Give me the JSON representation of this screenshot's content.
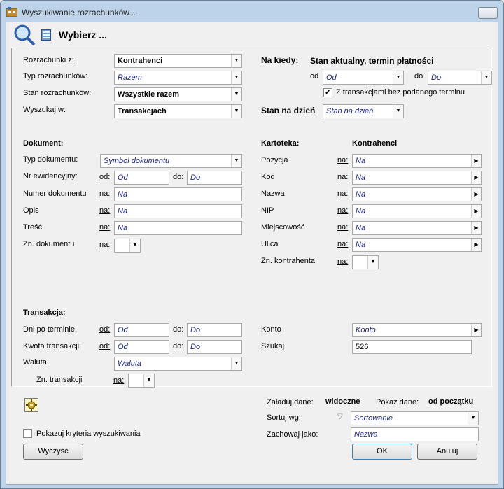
{
  "window": {
    "title": "Wyszukiwanie rozrachunków...",
    "close_glyph": "✕"
  },
  "header": {
    "title": "Wybierz ..."
  },
  "left_top": {
    "rozrachunki_label": "Rozrachunki z:",
    "rozrachunki_value": "Kontrahenci",
    "typ_label": "Typ rozrachunków:",
    "typ_value": "Razem",
    "stan_label": "Stan rozrachunków:",
    "stan_value": "Wszystkie razem",
    "wyszukaj_label": "Wyszukaj w:",
    "wyszukaj_value": "Transakcjach"
  },
  "right_top": {
    "na_kiedy_label": "Na kiedy:",
    "na_kiedy_value": "Stan aktualny, termin płatności",
    "od_label": "od",
    "od_placeholder": "Od",
    "do_label": "do",
    "do_placeholder": "Do",
    "checkbox_label": "Z transakcjami bez podanego terminu",
    "checkbox_checked": true,
    "stan_na_dzien_label": "Stan na dzień",
    "stan_na_dzien_placeholder": "Stan na dzień"
  },
  "dokument": {
    "section_title": "Dokument:",
    "typ_label": "Typ dokumentu:",
    "typ_placeholder": "Symbol dokumentu",
    "nr_label": "Nr ewidencyjny:",
    "od_label": "od:",
    "od_placeholder": "Od",
    "do_label": "do:",
    "do_placeholder": "Do",
    "numer_label": "Numer dokumentu",
    "na_label": "na:",
    "na_placeholder": "Na",
    "opis_label": "Opis",
    "tresc_label": "Treść",
    "zn_label": "Zn. dokumentu"
  },
  "kartoteka": {
    "section_title": "Kartoteka:",
    "section_value": "Kontrahenci",
    "na_label": "na:",
    "na_placeholder": "Na",
    "rows": [
      "Pozycja",
      "Kod",
      "Nazwa",
      "NIP",
      "Miejscowość",
      "Ulica"
    ],
    "zn_label": "Zn. kontrahenta"
  },
  "transakcja": {
    "section_title": "Transakcja:",
    "dni_label": "Dni po terminie,",
    "kwota_label": "Kwota transakcji",
    "od_label": "od:",
    "od_placeholder": "Od",
    "do_label": "do:",
    "do_placeholder": "Do",
    "waluta_label": "Waluta",
    "waluta_placeholder": "Waluta",
    "zn_label": "Zn. transakcji",
    "na_label": "na:",
    "konto_label": "Konto",
    "konto_placeholder": "Konto",
    "szukaj_label": "Szukaj",
    "szukaj_value": "526"
  },
  "bottom": {
    "zaladuj_label": "Załaduj dane:",
    "zaladuj_value": "widoczne",
    "pokaz_label": "Pokaż dane:",
    "pokaz_value": "od początku",
    "sortuj_label": "Sortuj wg:",
    "sortuj_placeholder": "Sortowanie",
    "zachowaj_label": "Zachowaj jako:",
    "zachowaj_value": "Nazwa",
    "pokazuj_label": "Pokazuj kryteria wyszukiwania",
    "pokazuj_checked": false,
    "wyczysc_label": "Wyczyść",
    "ok_label": "OK",
    "anuluj_label": "Anuluj"
  },
  "icons": {
    "dropdown": "▼",
    "arrow_right": "▶",
    "check": "✔",
    "sort_funnel": "▽"
  }
}
